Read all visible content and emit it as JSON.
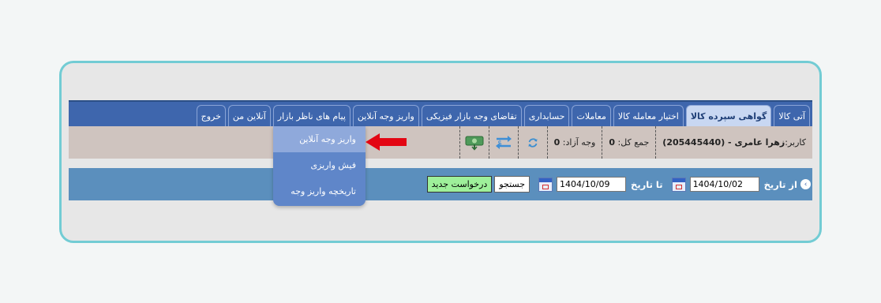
{
  "nav": {
    "tabs": [
      {
        "label": "آتی کالا",
        "active": false
      },
      {
        "label": "گواهی سپرده کالا",
        "active": true
      },
      {
        "label": "اختیار معامله کالا",
        "active": false
      },
      {
        "label": "معاملات",
        "active": false
      },
      {
        "label": "حسابداری",
        "active": false
      },
      {
        "label": "تقاضای وجه بازار فیزیکی",
        "active": false
      },
      {
        "label": "واریز وجه آنلاین",
        "active": false
      },
      {
        "label": "پیام های ناظر بازار",
        "active": false
      },
      {
        "label": "آنلاین من",
        "active": false
      },
      {
        "label": "خروج",
        "active": false
      }
    ]
  },
  "info": {
    "user_prefix": "کاربر:",
    "user_name": "زهرا عامری - (205445440)",
    "total_label": "جمع کل:",
    "total_value": "0",
    "free_label": "وجه آزاد:",
    "free_value": "0"
  },
  "search": {
    "from_label": "از تاریخ",
    "from_date": "1404/10/02",
    "to_label": "تا تاریخ",
    "to_date": "1404/10/09",
    "search_button": "جستجو",
    "new_request_button": "درخواست جدید"
  },
  "dropdown": {
    "items": [
      "واریز وجه آنلاین",
      "فیش واریزی",
      "تاریخچه واریز وجه"
    ]
  },
  "colors": {
    "nav_bg": "#3e66ad",
    "info_bg": "#cfc4bf",
    "search_bg": "#5b8fbd",
    "frame_border": "#72ccd4",
    "arrow": "#e30613",
    "new_button": "#9ef09a"
  },
  "icons": [
    "refresh-icon",
    "transfer-icon",
    "money-icon",
    "calendar-icon",
    "red-arrow-icon"
  ]
}
